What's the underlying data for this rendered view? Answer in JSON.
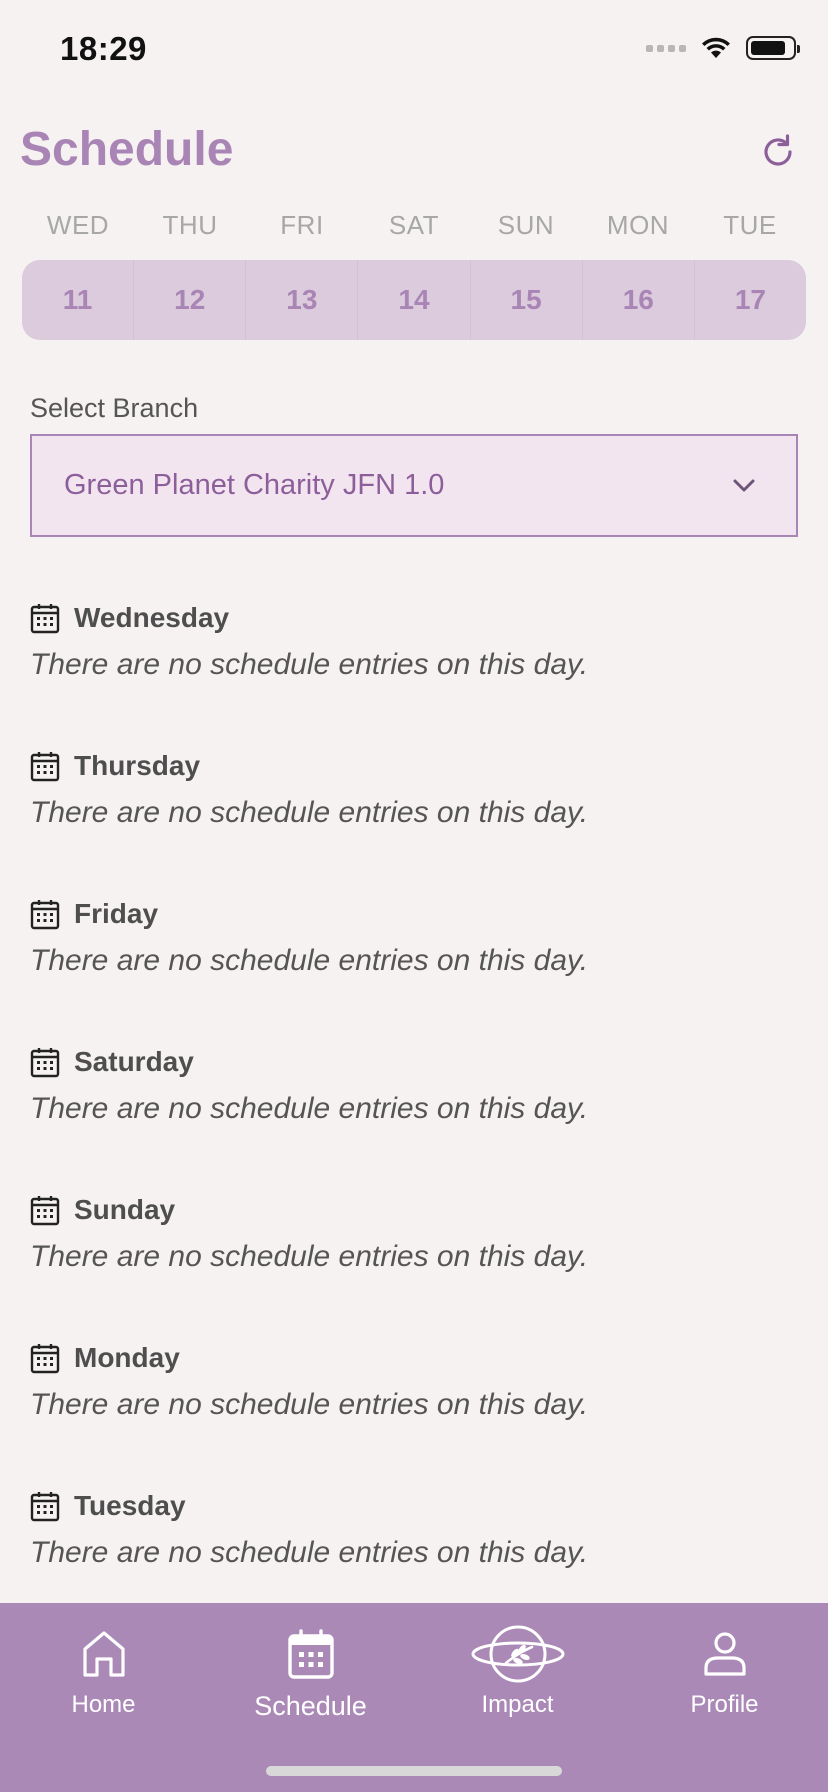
{
  "status_bar": {
    "time": "18:29"
  },
  "header": {
    "title": "Schedule",
    "refresh_icon": "refresh-icon"
  },
  "week": {
    "days": [
      {
        "abbr": "WED",
        "date": "11"
      },
      {
        "abbr": "THU",
        "date": "12"
      },
      {
        "abbr": "FRI",
        "date": "13"
      },
      {
        "abbr": "SAT",
        "date": "14"
      },
      {
        "abbr": "SUN",
        "date": "15"
      },
      {
        "abbr": "MON",
        "date": "16"
      },
      {
        "abbr": "TUE",
        "date": "17"
      }
    ]
  },
  "branch": {
    "label": "Select Branch",
    "selected": "Green Planet Charity JFN 1.0"
  },
  "schedule": [
    {
      "day": "Wednesday",
      "message": "There are no schedule entries on this day."
    },
    {
      "day": "Thursday",
      "message": "There are no schedule entries on this day."
    },
    {
      "day": "Friday",
      "message": "There are no schedule entries on this day."
    },
    {
      "day": "Saturday",
      "message": "There are no schedule entries on this day."
    },
    {
      "day": "Sunday",
      "message": "There are no schedule entries on this day."
    },
    {
      "day": "Monday",
      "message": "There are no schedule entries on this day."
    },
    {
      "day": "Tuesday",
      "message": "There are no schedule entries on this day."
    }
  ],
  "nav": {
    "home": "Home",
    "schedule": "Schedule",
    "impact": "Impact",
    "profile": "Profile"
  },
  "colors": {
    "accent": "#a985b6",
    "nav_background": "#ab89b7",
    "page_background": "#f6f2f1",
    "date_strip": "#dccbdd",
    "select_background": "#f2e5f0"
  }
}
